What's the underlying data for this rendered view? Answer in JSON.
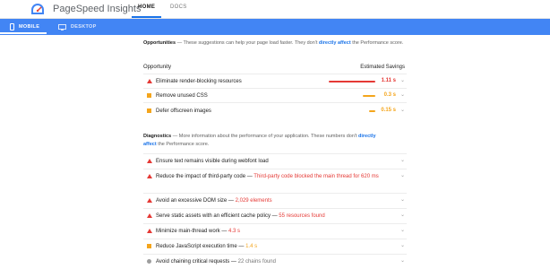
{
  "app": {
    "brand": "PageSpeed Insights",
    "nav": {
      "home": "HOME",
      "docs": "DOCS"
    }
  },
  "tabs": {
    "mobile": "MOBILE",
    "desktop": "DESKTOP"
  },
  "opportunities": {
    "title": "Opportunities",
    "desc_pre": " — These suggestions can help your page load faster. They don't ",
    "desc_link": "directly affect",
    "desc_post": " the Performance score.",
    "col_left": "Opportunity",
    "col_right": "Estimated Savings",
    "items": [
      {
        "label": "Eliminate render-blocking resources",
        "value": "1.11 s",
        "status": "fail",
        "bar_fraction": 0.88
      },
      {
        "label": "Remove unused CSS",
        "value": "0.3 s",
        "status": "average",
        "bar_fraction": 0.24
      },
      {
        "label": "Defer offscreen images",
        "value": "0.15 s",
        "status": "average",
        "bar_fraction": 0.12
      }
    ]
  },
  "diagnostics": {
    "title": "Diagnostics",
    "desc_pre": " — More information about the performance of your application. These numbers don't ",
    "desc_link_a": "directly",
    "desc_link_b": "affect",
    "desc_post": " the Performance score.",
    "items": [
      {
        "label": "Ensure text remains visible during webfont load",
        "detail": "",
        "status": "fail"
      },
      {
        "label": "Reduce the impact of third-party code",
        "detail": "Third-party code blocked the main thread for 620 ms",
        "status": "fail"
      },
      {
        "label": "Avoid an excessive DOM size",
        "detail": "2,029 elements",
        "status": "fail"
      },
      {
        "label": "Serve static assets with an efficient cache policy",
        "detail": "55 resources found",
        "status": "fail"
      },
      {
        "label": "Minimize main-thread work",
        "detail": "4.3 s",
        "status": "fail"
      },
      {
        "label": "Reduce JavaScript execution time",
        "detail": "1.4 s",
        "status": "average"
      },
      {
        "label": "Avoid chaining critical requests",
        "detail": "22 chains found",
        "status": "info"
      }
    ]
  },
  "colors": {
    "fail": "#e53935",
    "average": "#f4a51c",
    "info": "#9e9e9e",
    "link": "#1a73e8",
    "tabbar": "#4285f4"
  },
  "icons": {
    "fail": "red-triangle-icon",
    "average": "orange-square-icon",
    "info": "grey-circle-icon",
    "expand": "chevron-down-icon"
  }
}
